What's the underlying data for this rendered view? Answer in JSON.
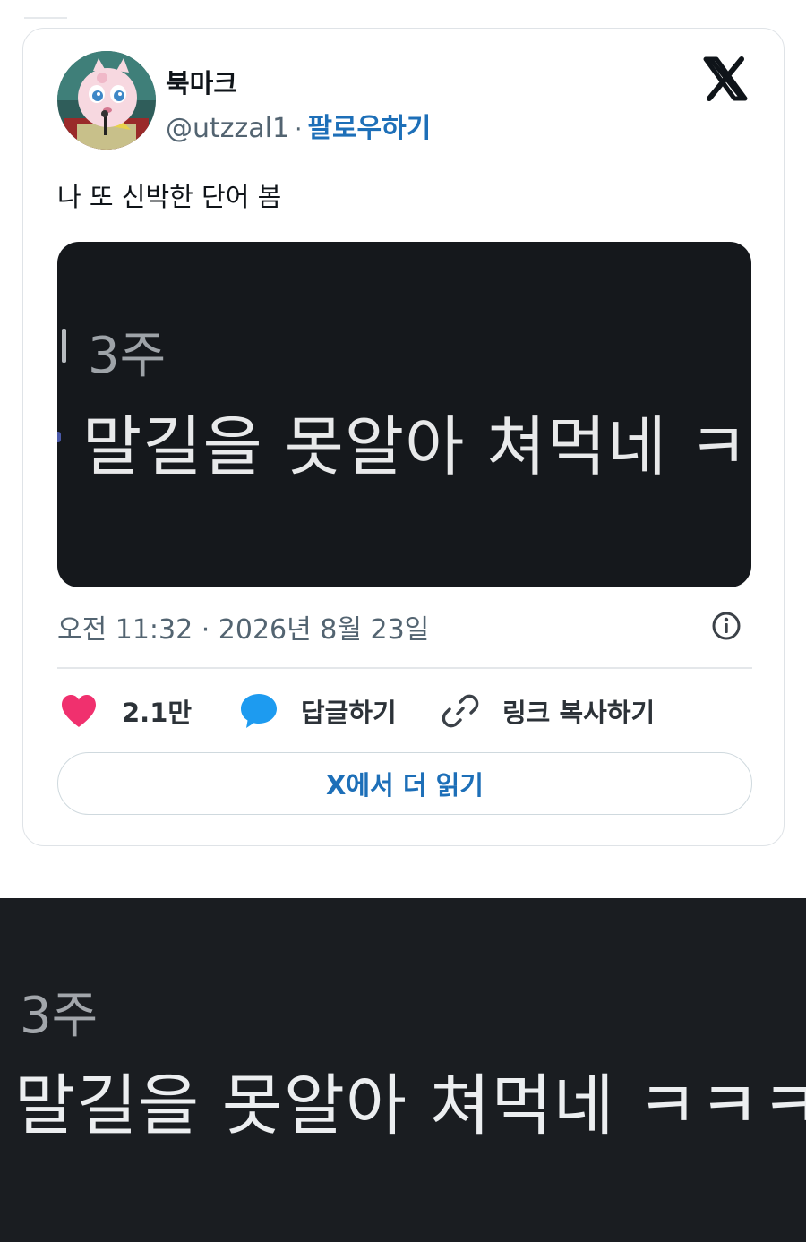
{
  "tweet": {
    "display_name": "북마크",
    "handle": "@utzzal1",
    "separator": "·",
    "follow_label": "팔로우하기",
    "text": "나 또 신박한 단어 봄",
    "timestamp": "오전 11:32 · 2026년 8월 23일",
    "media": {
      "ago": "3주",
      "comment": "말길을 못알아 쳐먹네 ㅋㅋ"
    },
    "actions": {
      "like_count": "2.1만",
      "reply_label": "답글하기",
      "copy_link_label": "링크 복사하기"
    },
    "read_more_label": "X에서 더 읽기"
  },
  "bottom_image": {
    "ago": "3주",
    "comment": "말길을 못알아 쳐먹네 ㅋㅋㅋㅋ"
  },
  "colors": {
    "follow_blue": "#1d6fb8",
    "like_pink": "#f0306e",
    "reply_blue": "#1d9bf0",
    "media_bg": "#15181c"
  },
  "icons": {
    "brand": "x-logo-icon",
    "like": "heart-icon",
    "reply": "speech-bubble-icon",
    "copy_link": "link-icon",
    "info": "info-icon"
  }
}
